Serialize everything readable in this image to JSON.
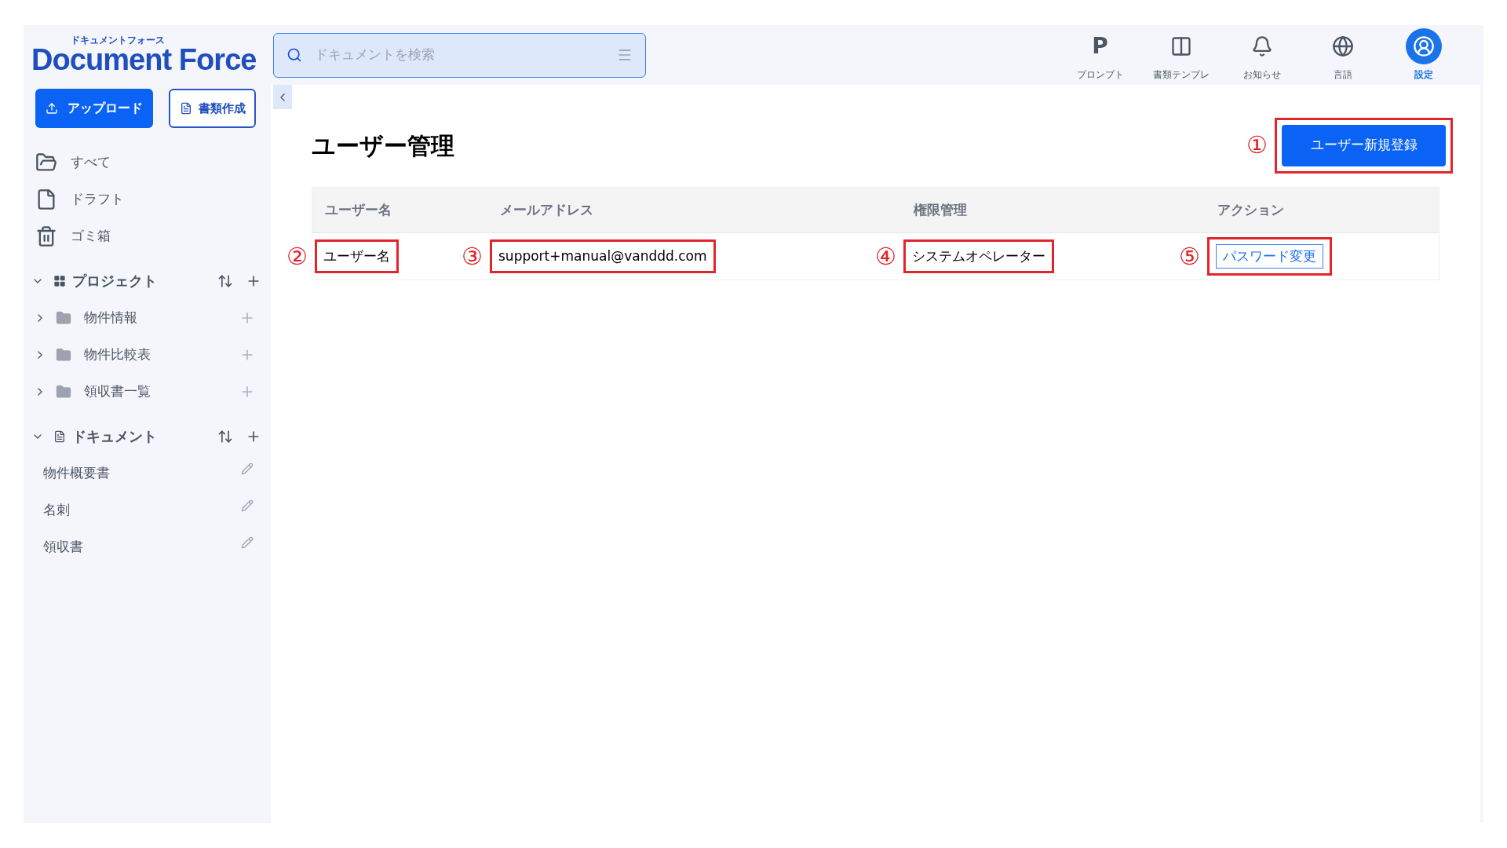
{
  "logo": {
    "kana": "ドキュメントフォース",
    "name": "Document Force"
  },
  "search": {
    "placeholder": "ドキュメントを検索"
  },
  "toolbar": [
    {
      "label": "プロンプト",
      "kind": "prompt",
      "glyph": "P",
      "selected": false
    },
    {
      "label": "書類テンプレ",
      "kind": "template",
      "selected": false
    },
    {
      "label": "お知らせ",
      "kind": "notice",
      "selected": false
    },
    {
      "label": "言語",
      "kind": "language",
      "selected": false
    },
    {
      "label": "設定",
      "kind": "settings",
      "selected": true
    }
  ],
  "sidebar": {
    "upload_button": "アップロード",
    "create_button": "書類作成",
    "nav": [
      {
        "label": "すべて",
        "kind": "all"
      },
      {
        "label": "ドラフト",
        "kind": "draft"
      },
      {
        "label": "ゴミ箱",
        "kind": "trash"
      }
    ],
    "sections": [
      {
        "title": "プロジェクト",
        "kind": "project",
        "expanded": true,
        "items": [
          {
            "label": "物件情報",
            "expanded": false
          },
          {
            "label": "物件比較表",
            "expanded": false
          },
          {
            "label": "領収書一覧",
            "expanded": false
          }
        ]
      },
      {
        "title": "ドキュメント",
        "kind": "document",
        "expanded": true,
        "items": [
          {
            "label": "物件概要書"
          },
          {
            "label": "名刺"
          },
          {
            "label": "領収書"
          }
        ]
      }
    ]
  },
  "page": {
    "title": "ユーザー管理",
    "new_button": {
      "label": "ユーザー新規登録",
      "marker": "①"
    },
    "table": {
      "columns": [
        "ユーザー名",
        "メールアドレス",
        "権限管理",
        "アクション"
      ],
      "rows": [
        {
          "cells": [
            {
              "text": "ユーザー名",
              "kind": "text",
              "marker": "②"
            },
            {
              "text": "support+manual@vanddd.com",
              "kind": "text",
              "marker": "③"
            },
            {
              "text": "システムオペレーター",
              "kind": "text",
              "marker": "④"
            },
            {
              "text": "パスワード変更",
              "kind": "link",
              "marker": "⑤"
            }
          ]
        }
      ]
    }
  }
}
